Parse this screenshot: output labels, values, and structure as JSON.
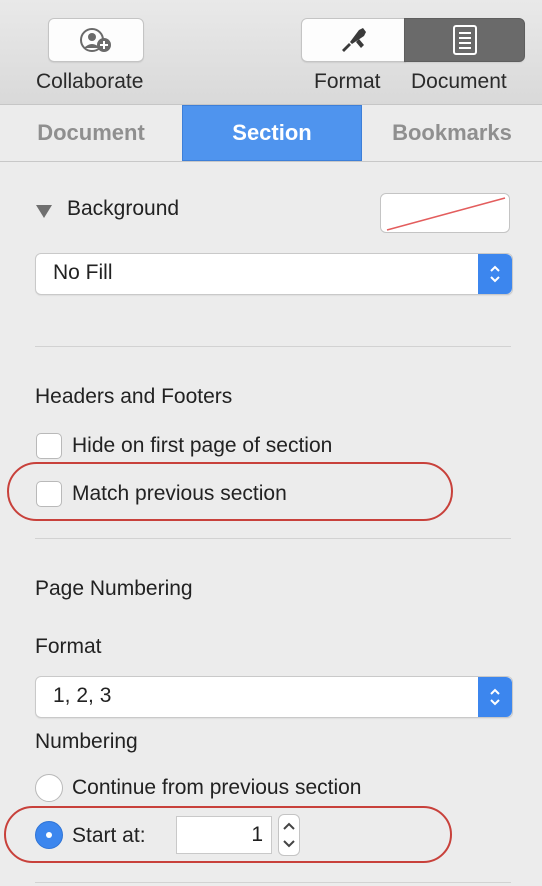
{
  "toolbar": {
    "collaborate_label": "Collaborate",
    "format_label": "Format",
    "document_label": "Document"
  },
  "tabs": [
    {
      "label": "Document",
      "active": false
    },
    {
      "label": "Section",
      "active": true
    },
    {
      "label": "Bookmarks",
      "active": false
    }
  ],
  "background": {
    "heading": "Background",
    "fill_select_value": "No Fill"
  },
  "headers_footers": {
    "heading": "Headers and Footers",
    "hide_first_page_label": "Hide on first page of section",
    "hide_first_page_checked": false,
    "match_previous_label": "Match previous section",
    "match_previous_checked": false
  },
  "page_numbering": {
    "heading": "Page Numbering",
    "format_label": "Format",
    "format_value": "1, 2, 3",
    "numbering_label": "Numbering",
    "continue_label": "Continue from previous section",
    "continue_selected": false,
    "start_at_label": "Start at:",
    "start_at_selected": true,
    "start_at_value": "1"
  },
  "colors": {
    "accent": "#3c86ee",
    "tab_active": "#4f94ee",
    "highlight": "#c8413b"
  }
}
